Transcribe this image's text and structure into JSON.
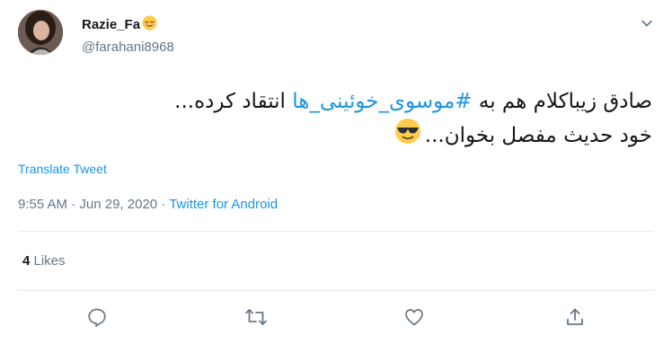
{
  "user": {
    "display_name": "Razie_Fa",
    "name_emoji": "relieved-face-emoji",
    "handle": "@farahani8968"
  },
  "tweet": {
    "line1_before": "صادق زیباکلام هم به ",
    "hashtag": "#موسوی_خوئینی_ها",
    "line1_after": " انتقاد کرده...",
    "line2": "خود حدیث مفصل بخوان...",
    "line2_emoji": "smiling-face-with-sunglasses-emoji"
  },
  "translate_label": "Translate Tweet",
  "meta": {
    "time": "9:55 AM",
    "sep1": " · ",
    "date": "Jun 29, 2020",
    "sep2": " · ",
    "source": "Twitter for Android"
  },
  "stats": {
    "likes_count": "4",
    "likes_label": " Likes"
  },
  "icons": {
    "caret": "chevron-down-icon",
    "reply": "reply-icon",
    "retweet": "retweet-icon",
    "like": "heart-icon",
    "share": "share-icon"
  },
  "colors": {
    "link": "#1b95e0",
    "secondary_text": "#657786",
    "icon": "#657786",
    "divider": "#e6ecf0"
  }
}
